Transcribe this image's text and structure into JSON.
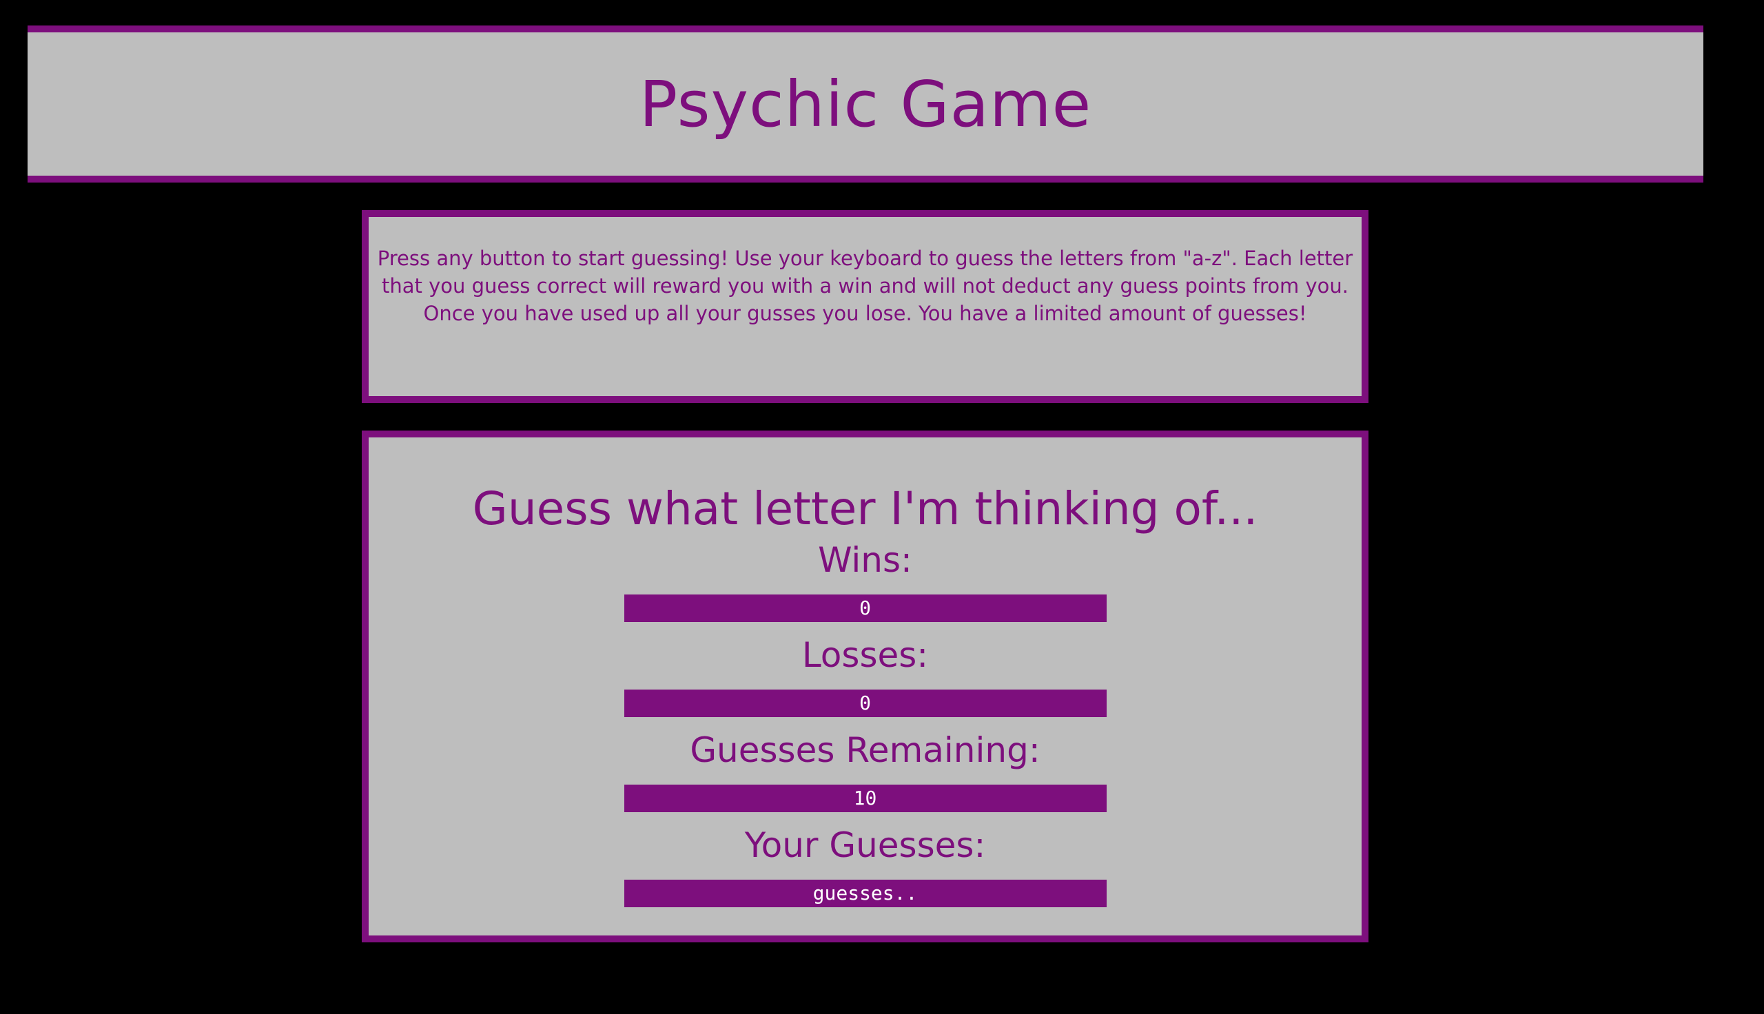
{
  "header": {
    "title": "Psychic Game"
  },
  "instructions": {
    "text": "Press any button to start guessing! Use your keyboard to guess the letters from \"a-z\". Each letter that you guess correct will reward you with a win and will not deduct any guess points from you. Once you have used up all your gusses you lose. You have a limited amount of guesses!"
  },
  "game": {
    "heading": "Guess what letter I'm thinking of...",
    "wins_label": "Wins:",
    "wins_value": "0",
    "losses_label": "Losses:",
    "losses_value": "0",
    "remaining_label": "Guesses Remaining:",
    "remaining_value": "10",
    "guesses_label": "Your Guesses:",
    "guesses_value": "guesses.."
  },
  "colors": {
    "background": "#000000",
    "panel": "#bebebe",
    "accent": "#7d0f7d",
    "value_text": "#ffffff"
  }
}
